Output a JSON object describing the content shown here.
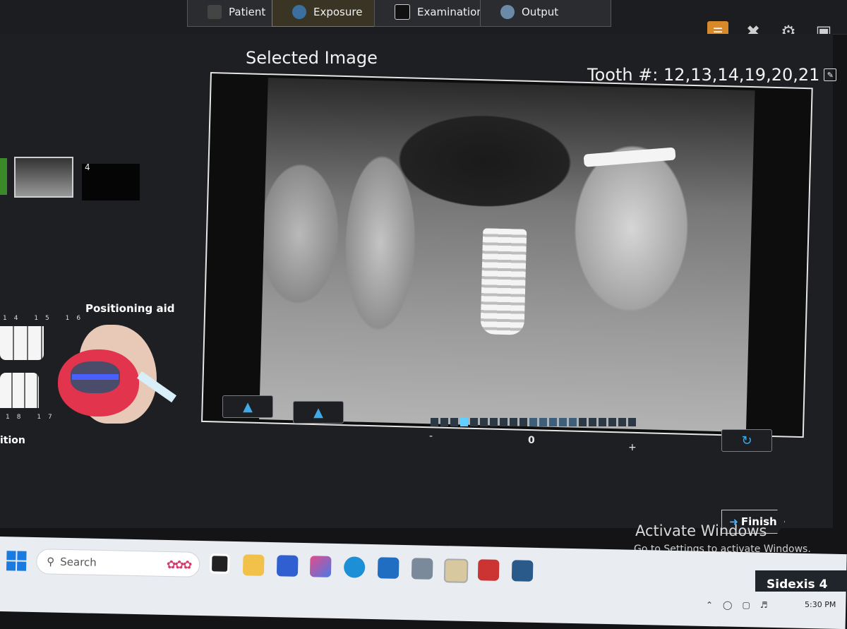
{
  "workflow": {
    "patient": "Patient",
    "exposure": "Exposure",
    "examination": "Examination",
    "output": "Output"
  },
  "top_icons": [
    "book-icon",
    "tools-icon",
    "gear-icon",
    "monitor-icon"
  ],
  "selected_image": {
    "title": "Selected Image",
    "tooth_label": "Tooth #: 12,13,14,19,20,21"
  },
  "thumbnails": {
    "second_index": "4"
  },
  "brightness": {
    "minus": "-",
    "zero": "0",
    "plus": "+",
    "level": 0.14
  },
  "positioning": {
    "title": "Positioning aid",
    "left_label": "ition",
    "top_numbers": "14 15 16",
    "bottom_numbers": "18 17"
  },
  "finish_label": "Finish",
  "activation": {
    "title": "Activate Windows",
    "subtitle": "Go to Settings to activate Windows."
  },
  "taskbar": {
    "search_placeholder": "Search",
    "app_name": "Sidexis 4",
    "clock": "5:30 PM"
  },
  "colors": {
    "accent": "#3fa9e8",
    "holder": "#e2344d",
    "bar_active": "#5fd0ff"
  }
}
